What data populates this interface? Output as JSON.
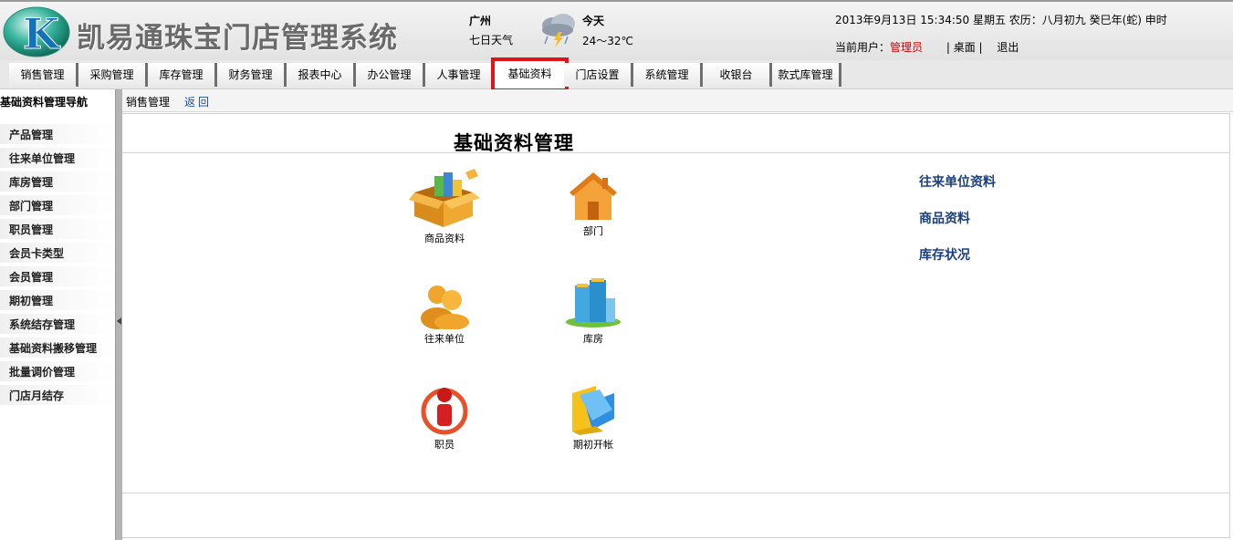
{
  "header": {
    "logo_letter": "K",
    "app_title": "凯易通珠宝门店管理系统",
    "city": "广州",
    "forecast_link": "七日天气",
    "today_label": "今天",
    "temperature": "24～32℃",
    "datetime": "2013年9月13日  15:34:50 星期五  农历：八月初九  癸巳年(蛇) 申时",
    "user_label": "当前用户：",
    "user_name": "管理员",
    "desktop_link": "| 桌面 |",
    "logout_link": "退出"
  },
  "nav": {
    "tabs": [
      {
        "label": "销售管理"
      },
      {
        "label": "采购管理"
      },
      {
        "label": "库存管理"
      },
      {
        "label": "财务管理"
      },
      {
        "label": "报表中心"
      },
      {
        "label": "办公管理"
      },
      {
        "label": "人事管理"
      },
      {
        "label": "基础资料"
      },
      {
        "label": "门店设置"
      },
      {
        "label": "系统管理"
      },
      {
        "label": "收银台"
      },
      {
        "label": "款式库管理"
      }
    ],
    "active": "基础资料"
  },
  "sidebar": {
    "title": "基础资料管理导航",
    "items": [
      {
        "label": "产品管理"
      },
      {
        "label": "往来单位管理"
      },
      {
        "label": "库房管理"
      },
      {
        "label": "部门管理"
      },
      {
        "label": "职员管理"
      },
      {
        "label": "会员卡类型"
      },
      {
        "label": "会员管理"
      },
      {
        "label": "期初管理"
      },
      {
        "label": "系统结存管理"
      },
      {
        "label": "基础资料搬移管理"
      },
      {
        "label": "批量调价管理"
      },
      {
        "label": "门店月结存"
      }
    ]
  },
  "breadcrumb": {
    "current": "销售管理",
    "back": "返回"
  },
  "main": {
    "title": "基础资料管理",
    "tiles": [
      {
        "label": "商品资料",
        "icon": "product-box-icon"
      },
      {
        "label": "部门",
        "icon": "house-icon"
      },
      {
        "label": "往来单位",
        "icon": "people-icon"
      },
      {
        "label": "库房",
        "icon": "building-icon"
      },
      {
        "label": "职员",
        "icon": "person-icon"
      },
      {
        "label": "期初开帐",
        "icon": "folder-icon"
      }
    ],
    "quick_links": [
      {
        "label": "往来单位资料"
      },
      {
        "label": "商品资料"
      },
      {
        "label": "库存状况"
      }
    ]
  },
  "colors": {
    "active_tab_outline": "#e0151a",
    "user_name": "#d40000",
    "link_blue": "#1a4080"
  }
}
